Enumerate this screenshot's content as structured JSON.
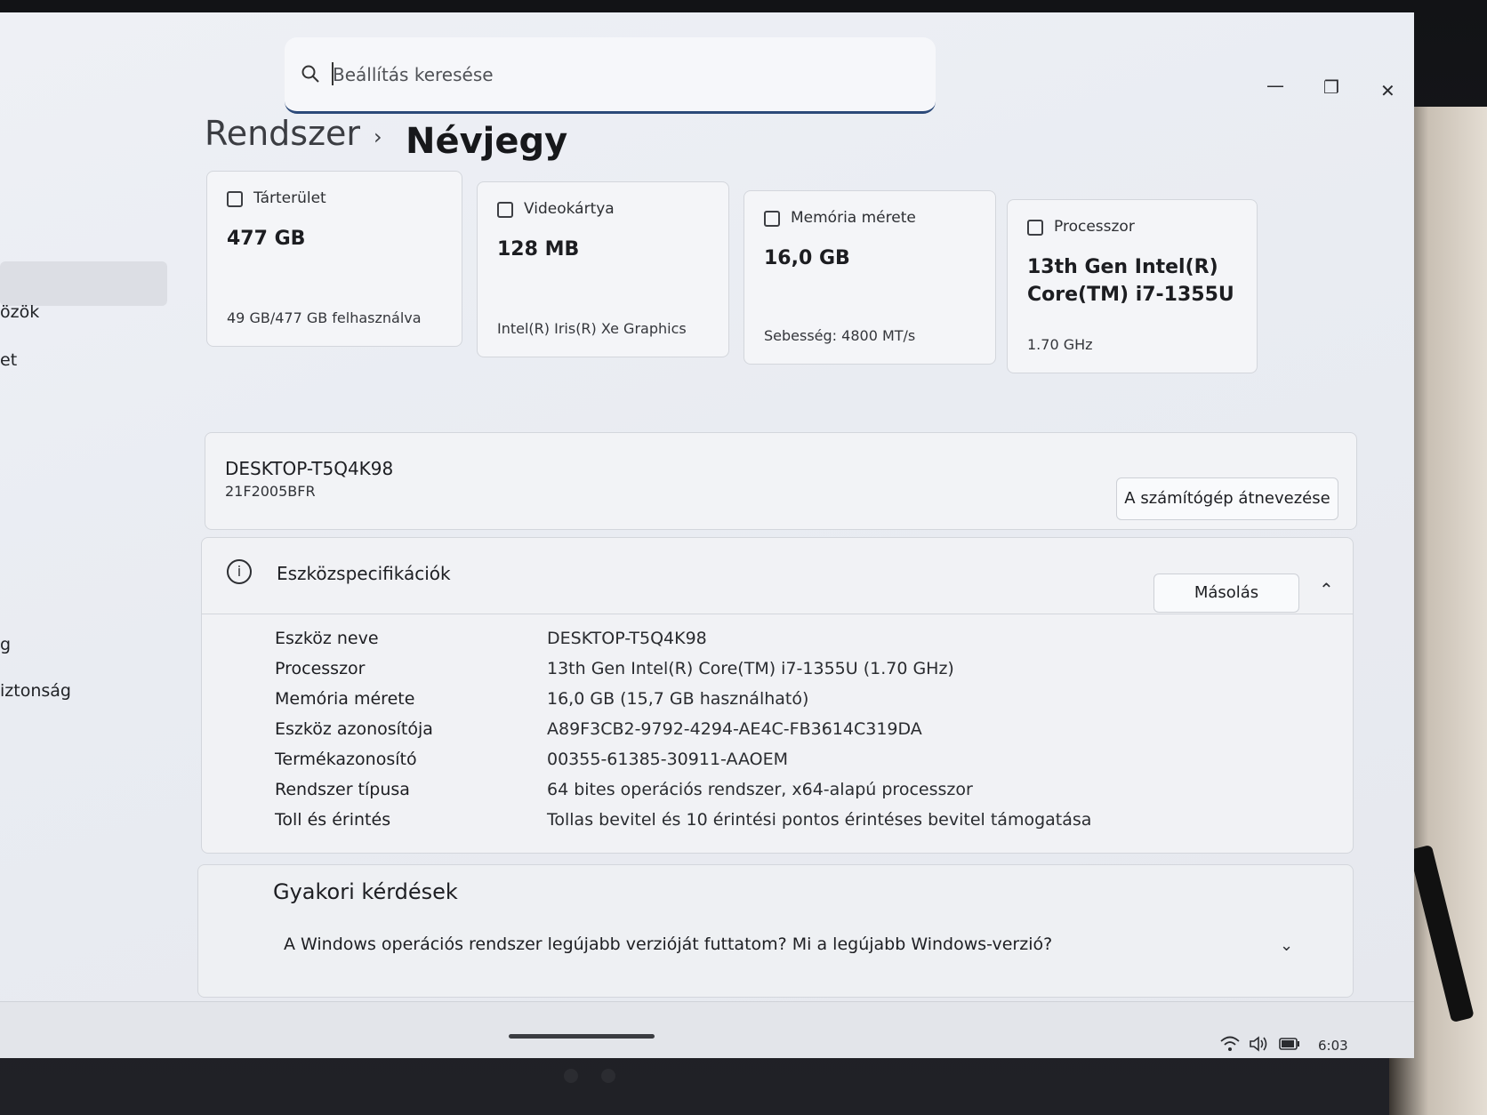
{
  "search": {
    "placeholder": "Beállítás keresése"
  },
  "window": {
    "minimize": "—",
    "maximize": "❐",
    "close": "✕"
  },
  "breadcrumb": {
    "parent": "Rendszer",
    "separator": "›",
    "current": "Névjegy"
  },
  "sidebar": {
    "items": [
      "özök",
      "et",
      "g",
      "iztonság"
    ]
  },
  "cards": [
    {
      "title": "Tárterület",
      "value": "477 GB",
      "sub": "49 GB/477 GB felhasználva",
      "icon": "storage-icon"
    },
    {
      "title": "Videokártya",
      "value": "128 MB",
      "sub": "Intel(R) Iris(R) Xe Graphics",
      "icon": "gpu-icon"
    },
    {
      "title": "Memória mérete",
      "value": "16,0 GB",
      "sub": "Sebesség: 4800 MT/s",
      "icon": "memory-icon"
    },
    {
      "title": "Processzor",
      "value": "13th Gen Intel(R) Core(TM) i7-1355U",
      "sub": "1.70 GHz",
      "icon": "cpu-icon"
    }
  ],
  "device": {
    "name": "DESKTOP-T5Q4K98",
    "model": "21F2005BFR",
    "rename_label": "A számítógép átnevezése"
  },
  "specs": {
    "title": "Eszközspecifikációk",
    "copy_label": "Másolás",
    "rows": [
      {
        "key": "Eszköz neve",
        "value": "DESKTOP-T5Q4K98"
      },
      {
        "key": "Processzor",
        "value": "13th Gen Intel(R) Core(TM) i7-1355U (1.70 GHz)"
      },
      {
        "key": "Memória mérete",
        "value": "16,0 GB (15,7 GB használható)"
      },
      {
        "key": "Eszköz azonosítója",
        "value": "A89F3CB2-9792-4294-AE4C-FB3614C319DA"
      },
      {
        "key": "Termékazonosító",
        "value": "00355-61385-30911-AAOEM"
      },
      {
        "key": "Rendszer típusa",
        "value": "64 bites operációs rendszer, x64-alapú processzor"
      },
      {
        "key": "Toll és érintés",
        "value": "Tollas bevitel és 10 érintési pontos érintéses bevitel támogatása"
      }
    ]
  },
  "faq": {
    "title": "Gyakori kérdések",
    "question": "A Windows operációs rendszer legújabb verzióját futtatom? Mi a legújabb Windows-verzió?"
  },
  "taskbar": {
    "clock": "6:03"
  }
}
